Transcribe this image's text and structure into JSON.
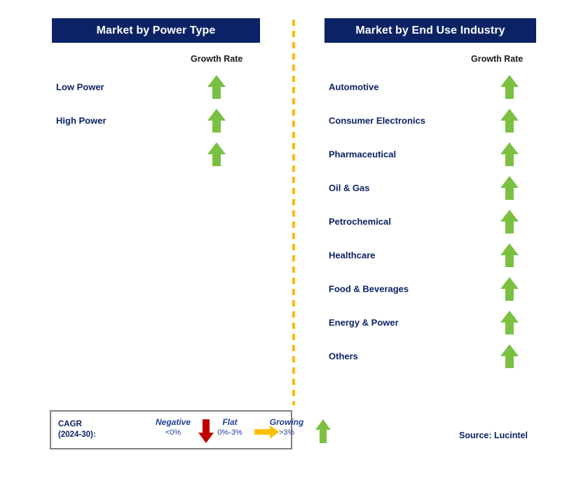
{
  "accent_colors": {
    "header_navy": "#0b2265",
    "label_navy": "#0b2265",
    "arrow_green": "#7ac143",
    "arrow_red": "#c00000",
    "arrow_amber": "#ffc000",
    "divider_amber": "#fdb913",
    "legend_border_gray": "#808080",
    "legend_text_blue": "#1f3f94"
  },
  "panels": {
    "left": {
      "title": "Market by Power Type",
      "growth_caption": "Growth Rate",
      "rows": [
        {
          "label": "Low Power",
          "growth": "Growing",
          "arrow": "up-arrow-icon"
        },
        {
          "label": "High Power",
          "growth": "Growing",
          "arrow": "up-arrow-icon"
        },
        {
          "label": "",
          "growth": "Growing",
          "arrow": "up-arrow-icon"
        }
      ]
    },
    "right": {
      "title": "Market by End Use Industry",
      "growth_caption": "Growth Rate",
      "rows": [
        {
          "label": "Automotive",
          "growth": "Growing",
          "arrow": "up-arrow-icon"
        },
        {
          "label": "Consumer Electronics",
          "growth": "Growing",
          "arrow": "up-arrow-icon"
        },
        {
          "label": "Pharmaceutical",
          "growth": "Growing",
          "arrow": "up-arrow-icon"
        },
        {
          "label": "Oil & Gas",
          "growth": "Growing",
          "arrow": "up-arrow-icon"
        },
        {
          "label": "Petrochemical",
          "growth": "Growing",
          "arrow": "up-arrow-icon"
        },
        {
          "label": "Healthcare",
          "growth": "Growing",
          "arrow": "up-arrow-icon"
        },
        {
          "label": "Food & Beverages",
          "growth": "Growing",
          "arrow": "up-arrow-icon"
        },
        {
          "label": "Energy & Power",
          "growth": "Growing",
          "arrow": "up-arrow-icon"
        },
        {
          "label": "Others",
          "growth": "Growing",
          "arrow": "up-arrow-icon"
        }
      ]
    }
  },
  "legend": {
    "title": "CAGR (2024-30):",
    "title_line1": "CAGR",
    "title_line2": "(2024-30):",
    "items": [
      {
        "name": "Negative",
        "range": "<0%",
        "icon": "down-arrow-icon"
      },
      {
        "name": "Flat",
        "range": "0%-3%",
        "icon": "right-arrow-icon"
      },
      {
        "name": "Growing",
        "range": ">3%",
        "icon": "up-arrow-icon"
      }
    ]
  },
  "source": "Source: Lucintel"
}
